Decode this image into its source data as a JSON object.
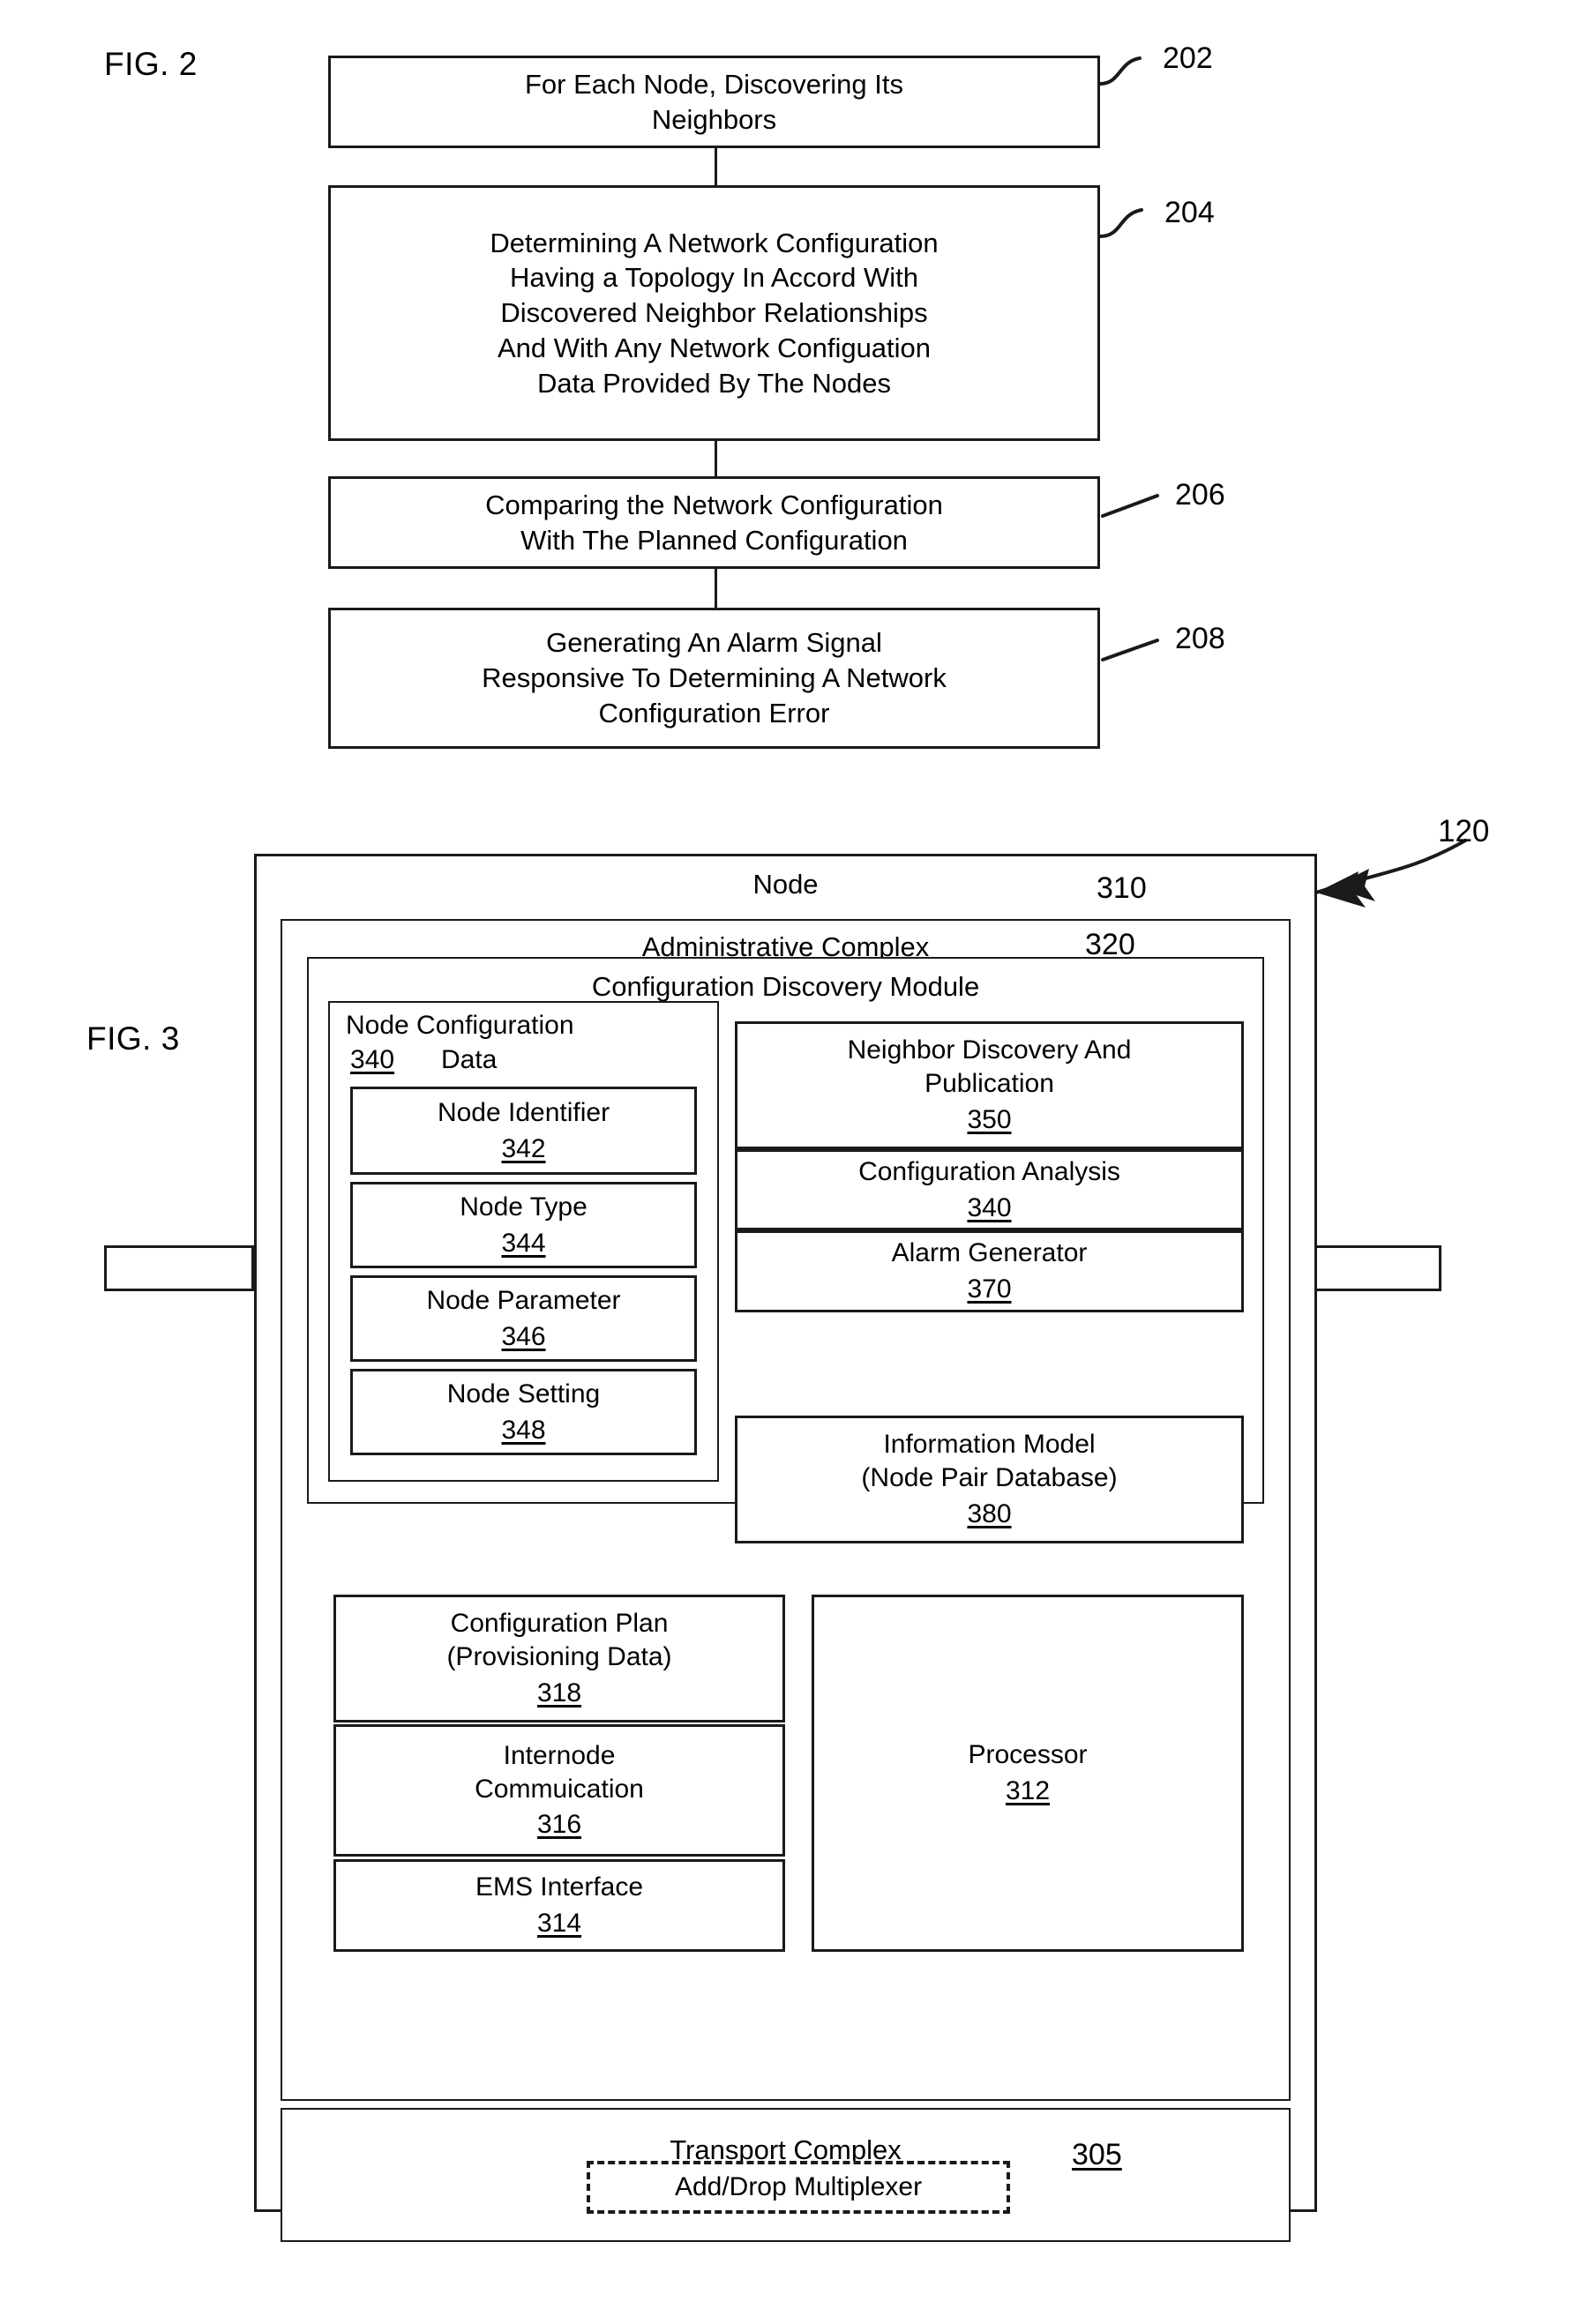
{
  "figure2": {
    "label": "FIG. 2",
    "steps": [
      {
        "ref": "202",
        "lines": [
          "For Each Node, Discovering Its",
          "Neighbors"
        ]
      },
      {
        "ref": "204",
        "lines": [
          "Determining A Network Configuration",
          "Having a Topology In Accord With",
          "Discovered Neighbor Relationships",
          "And With Any Network Configuation",
          "Data Provided By The Nodes"
        ]
      },
      {
        "ref": "206",
        "lines": [
          "Comparing the Network Configuration",
          "With The Planned Configuration"
        ]
      },
      {
        "ref": "208",
        "lines": [
          "Generating An Alarm Signal",
          "Responsive To Determining A Network",
          "Configuration Error"
        ]
      }
    ]
  },
  "figure3": {
    "label": "FIG. 3",
    "callout_ref": "120",
    "node": {
      "title": "Node",
      "ref": "310"
    },
    "administrative_complex": {
      "title": "Administrative Complex",
      "ref": "320"
    },
    "configuration_discovery_module": {
      "title": "Configuration Discovery Module"
    },
    "node_configuration_data": {
      "title_line1": "Node Configuration",
      "title_line2_ref": "340",
      "title_line2_word": "Data",
      "items": [
        {
          "title": "Node Identifier",
          "ref": "342"
        },
        {
          "title": "Node Type",
          "ref": "344"
        },
        {
          "title": "Node Parameter",
          "ref": "346"
        },
        {
          "title": "Node Setting",
          "ref": "348"
        }
      ]
    },
    "discovery_stack": [
      {
        "lines": [
          "Neighbor Discovery And",
          "Publication"
        ],
        "ref": "350"
      },
      {
        "lines": [
          "Configuration Analysis"
        ],
        "ref": "340"
      },
      {
        "lines": [
          "Alarm Generator"
        ],
        "ref": "370"
      }
    ],
    "information_model": {
      "lines": [
        "Information Model",
        "(Node Pair Database)"
      ],
      "ref": "380"
    },
    "left_stack": [
      {
        "lines": [
          "Configuration Plan",
          "(Provisioning Data)"
        ],
        "ref": "318"
      },
      {
        "lines": [
          "Internode",
          "Commuication"
        ],
        "ref": "316"
      },
      {
        "lines": [
          "EMS Interface"
        ],
        "ref": "314"
      }
    ],
    "processor": {
      "title": "Processor",
      "ref": "312"
    },
    "transport_complex": {
      "title": "Transport Complex",
      "inner_title": "Add/Drop Multiplexer",
      "ref": "305"
    }
  },
  "colors": {
    "ink": "#1a1a1a",
    "paper": "#ffffff"
  }
}
